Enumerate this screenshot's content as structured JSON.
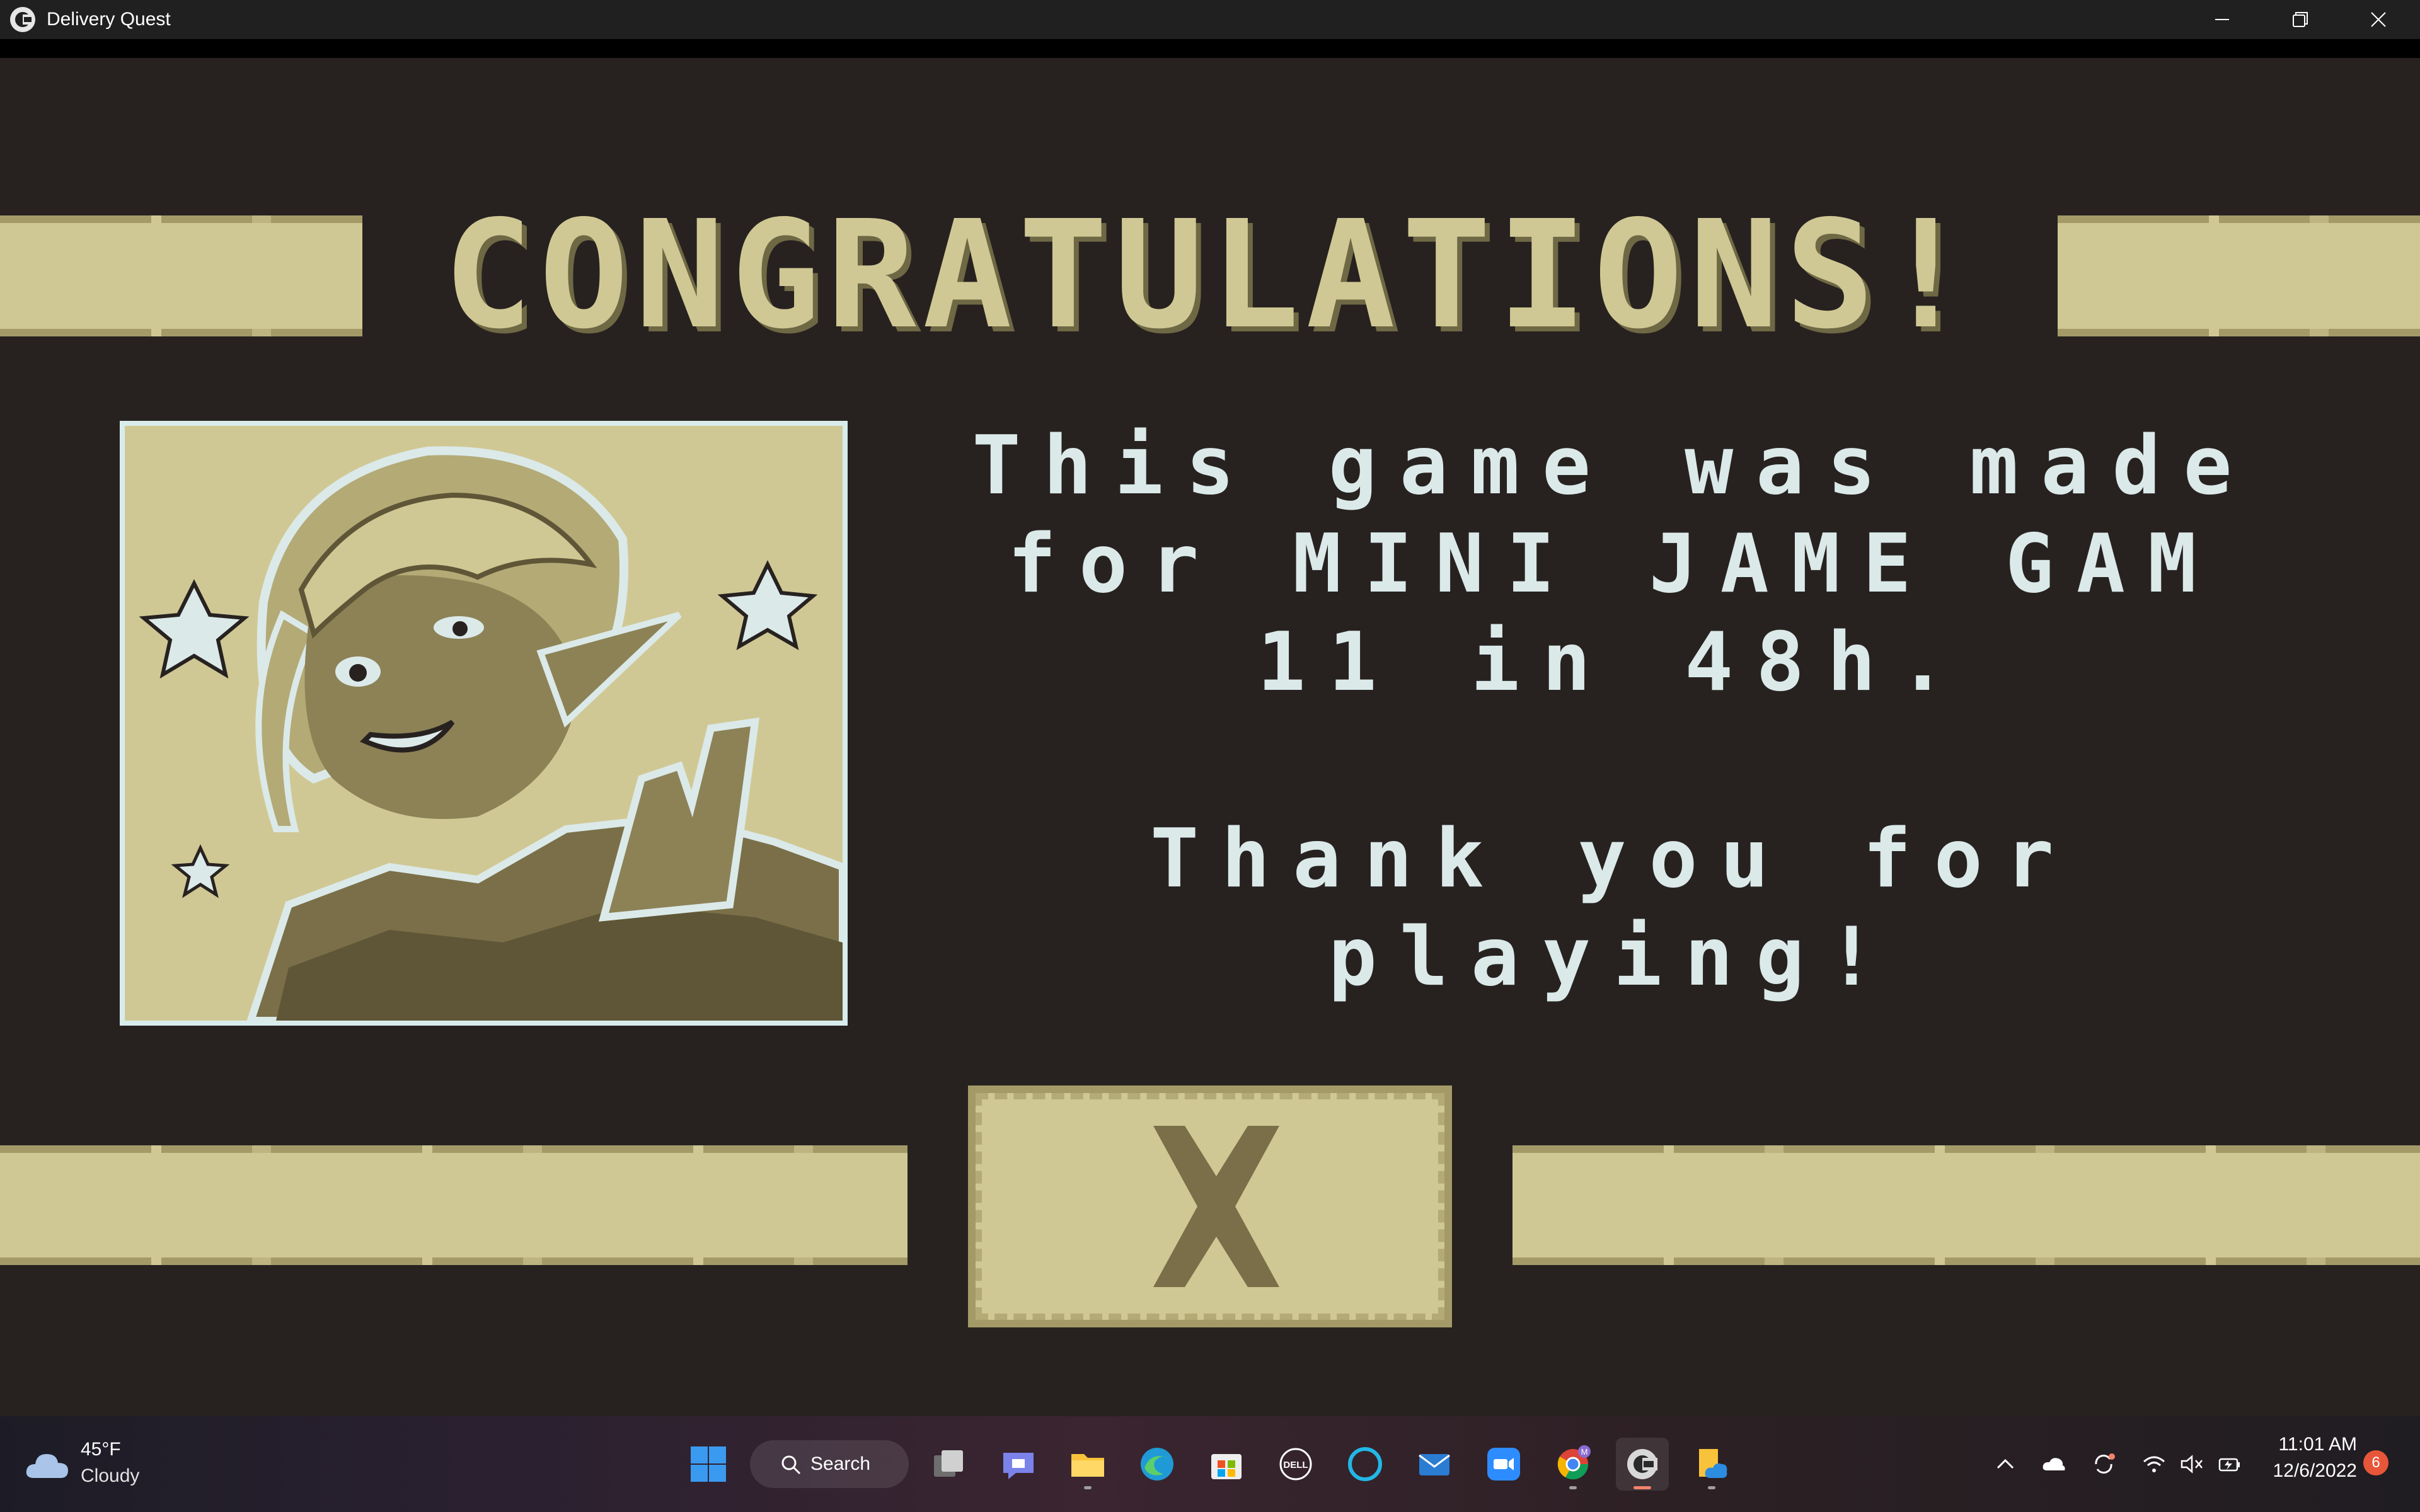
{
  "window": {
    "title": "Delivery Quest",
    "controls": {
      "minimize": "minimize-icon",
      "maximize": "restore-icon",
      "close": "close-icon"
    }
  },
  "game": {
    "heading": "CONGRATULATIONS!",
    "message_lines": [
      "This game was made",
      "for MINI JAME GAM",
      "11 in 48h.",
      "",
      "Thank you for",
      "playing!"
    ],
    "close_button_icon": "x-icon",
    "colors": {
      "background": "#272220",
      "accent": "#d0c894",
      "text": "#dbe9e9",
      "shadow": "#6e6844"
    }
  },
  "taskbar": {
    "weather": {
      "temp": "45°F",
      "condition": "Cloudy",
      "icon": "cloud-icon"
    },
    "search_label": "Search",
    "pinned": [
      "windows-start-icon",
      "task-view-icon",
      "teams-chat-icon",
      "file-explorer-icon",
      "edge-icon",
      "store-icon",
      "dell-icon",
      "alexa-icon",
      "mail-icon",
      "zoom-icon",
      "chrome-icon",
      "game-app-icon",
      "onedrive-folder-icon"
    ],
    "chrome_profile_badge": "M",
    "tray": [
      "chevron-up-icon",
      "onedrive-icon",
      "sync-icon",
      "wifi-icon",
      "volume-muted-icon",
      "battery-icon"
    ],
    "clock": {
      "time": "11:01 AM",
      "date": "12/6/2022"
    },
    "notifications": "6"
  }
}
